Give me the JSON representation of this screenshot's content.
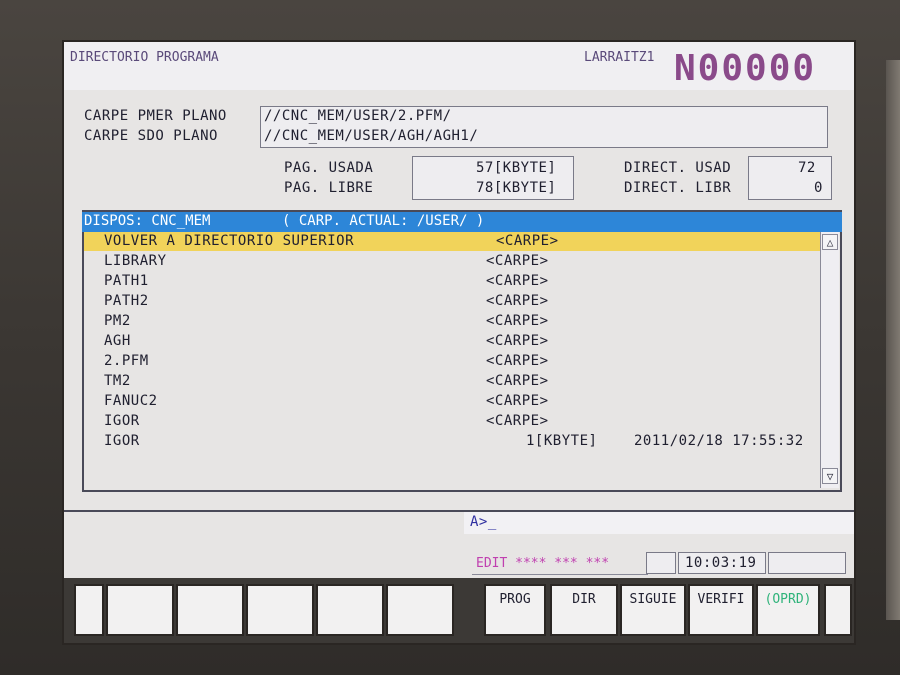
{
  "screen": {
    "title": "DIRECTORIO PROGRAMA",
    "machine_name": "LARRAITZ1",
    "program_number": "N00000"
  },
  "folders": {
    "foreground_label": "CARPE PMER PLANO",
    "foreground_path": "//CNC_MEM/USER/2.PFM/",
    "background_label": "CARPE SDO PLANO",
    "background_path": "//CNC_MEM/USER/AGH/AGH1/"
  },
  "memory": {
    "used_label": "PAG. USADA",
    "used_value": "57[KBYTE]",
    "free_label": "PAG. LIBRE",
    "free_value": "78[KBYTE]",
    "dir_used_label": "DIRECT. USAD",
    "dir_used_value": "72",
    "dir_free_label": "DIRECT. LIBR",
    "dir_free_value": "0"
  },
  "list": {
    "device_label": "DISPOS: CNC_MEM",
    "current_folder": "( CARP. ACTUAL: /USER/ )",
    "rows": [
      {
        "name": "VOLVER A DIRECTORIO SUPERIOR",
        "size": "<CARPE>",
        "date": ""
      },
      {
        "name": "LIBRARY",
        "size": "<CARPE>",
        "date": ""
      },
      {
        "name": "PATH1",
        "size": "<CARPE>",
        "date": ""
      },
      {
        "name": "PATH2",
        "size": "<CARPE>",
        "date": ""
      },
      {
        "name": "PM2",
        "size": "<CARPE>",
        "date": ""
      },
      {
        "name": "AGH",
        "size": "<CARPE>",
        "date": ""
      },
      {
        "name": "2.PFM",
        "size": "<CARPE>",
        "date": ""
      },
      {
        "name": "TM2",
        "size": "<CARPE>",
        "date": ""
      },
      {
        "name": "FANUC2",
        "size": "<CARPE>",
        "date": ""
      },
      {
        "name": "IGOR",
        "size": "<CARPE>",
        "date": ""
      },
      {
        "name": "IGOR",
        "size": "1[KBYTE]",
        "date": "2011/02/18 17:55:32"
      }
    ],
    "scroll_up": "△",
    "scroll_down": "▽"
  },
  "input": {
    "prompt": "A>_"
  },
  "status": {
    "mode": "EDIT **** *** ***",
    "time": "10:03:19"
  },
  "softkeys": [
    "",
    "",
    "",
    "",
    "",
    "PROG",
    "DIR",
    "SIGUIE",
    "VERIFI",
    "(OPRD)",
    ""
  ],
  "colors": {
    "header_blue": "#2d86d8",
    "highlight_yellow": "#f1d35a",
    "program_number": "#8a4a8a",
    "mode_magenta": "#c040b0",
    "oprd_green": "#2fb37a"
  }
}
